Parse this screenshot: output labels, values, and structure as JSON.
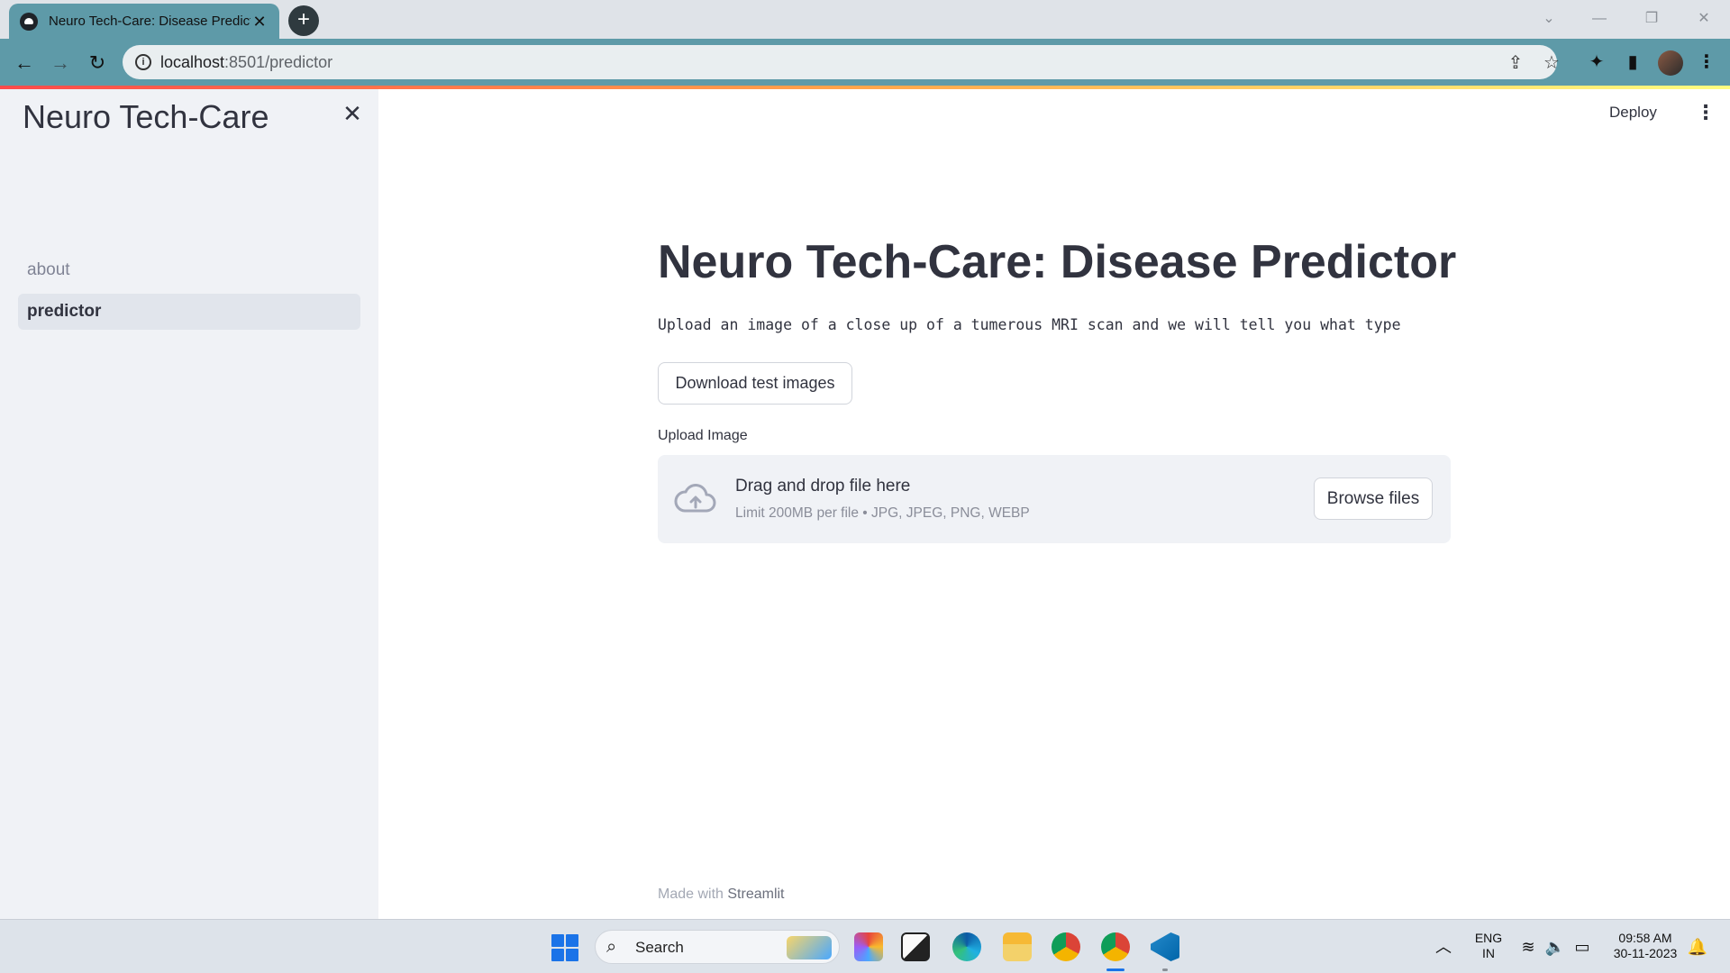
{
  "browser": {
    "tab_title": "Neuro Tech-Care: Disease Predictor",
    "url_host": "localhost",
    "url_path": ":8501/predictor"
  },
  "sidebar": {
    "title": "Neuro Tech-Care",
    "items": [
      {
        "label": "about",
        "active": false
      },
      {
        "label": "predictor",
        "active": true
      }
    ]
  },
  "header": {
    "deploy_label": "Deploy"
  },
  "main": {
    "title": "Neuro Tech-Care: Disease Predictor",
    "description": "Upload an image of a close up of a tumerous MRI scan and we will tell you what type",
    "download_button": "Download test images",
    "upload_label": "Upload Image",
    "dropzone": {
      "title": "Drag and drop file here",
      "limit": "Limit 200MB per file • JPG, JPEG, PNG, WEBP",
      "browse_button": "Browse files"
    },
    "footer_prefix": "Made with",
    "footer_brand": "Streamlit"
  },
  "taskbar": {
    "search_label": "Search",
    "lang_top": "ENG",
    "lang_bottom": "IN",
    "time": "09:58 AM",
    "date": "30-11-2023"
  },
  "colors": {
    "accent": "#5e9aa8",
    "sidebar_bg": "#f0f2f6",
    "text": "#31333f"
  }
}
